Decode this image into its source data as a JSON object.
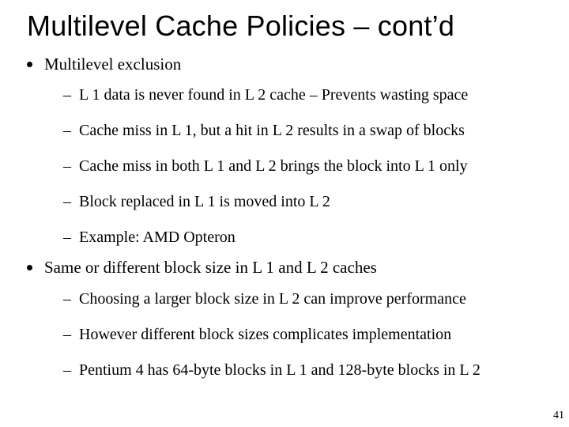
{
  "title": "Multilevel Cache Policies – cont’d",
  "bullets": [
    {
      "text": "Multilevel exclusion",
      "sub": [
        "L 1 data is never found in L 2 cache – Prevents wasting space",
        "Cache miss in L 1, but a hit in L 2 results in a swap of blocks",
        "Cache miss in both L 1 and L 2 brings the block into L 1 only",
        "Block replaced in L 1 is moved into L 2",
        "Example: AMD Opteron"
      ]
    },
    {
      "text": "Same or different block size in L 1 and L 2 caches",
      "sub": [
        "Choosing a larger block size in L 2 can improve performance",
        "However different block sizes complicates implementation",
        "Pentium 4 has 64-byte blocks in L 1 and 128-byte blocks in L 2"
      ]
    }
  ],
  "page_number": "41"
}
